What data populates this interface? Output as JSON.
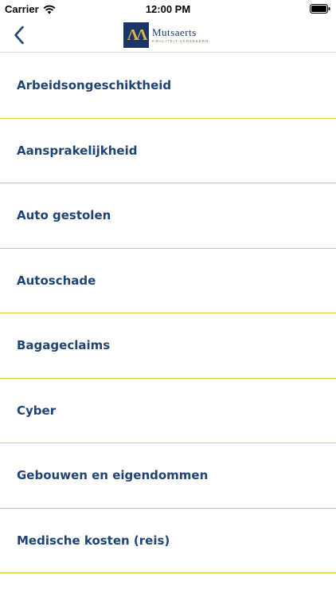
{
  "status_bar": {
    "carrier": "Carrier",
    "time": "12:00 PM",
    "icons": [
      "wifi-icon",
      "battery-icon"
    ]
  },
  "nav_bar": {
    "back_icon": "chevron-left-icon",
    "logo": {
      "name": "Mutsaerts",
      "tagline": "KWALITEIT VERZEKERD"
    }
  },
  "colors": {
    "accent": "#1f4473",
    "divider": "#e3c64a",
    "logo_bg": "#1a3566",
    "logo_gold": "#d9b54a"
  },
  "items": [
    {
      "label": "Arbeidsongeschiktheid"
    },
    {
      "label": "Aansprakelijkheid"
    },
    {
      "label": "Auto gestolen"
    },
    {
      "label": "Autoschade"
    },
    {
      "label": "Bagageclaims"
    },
    {
      "label": "Cyber"
    },
    {
      "label": "Gebouwen en eigendommen"
    },
    {
      "label": "Medische kosten (reis)"
    }
  ]
}
